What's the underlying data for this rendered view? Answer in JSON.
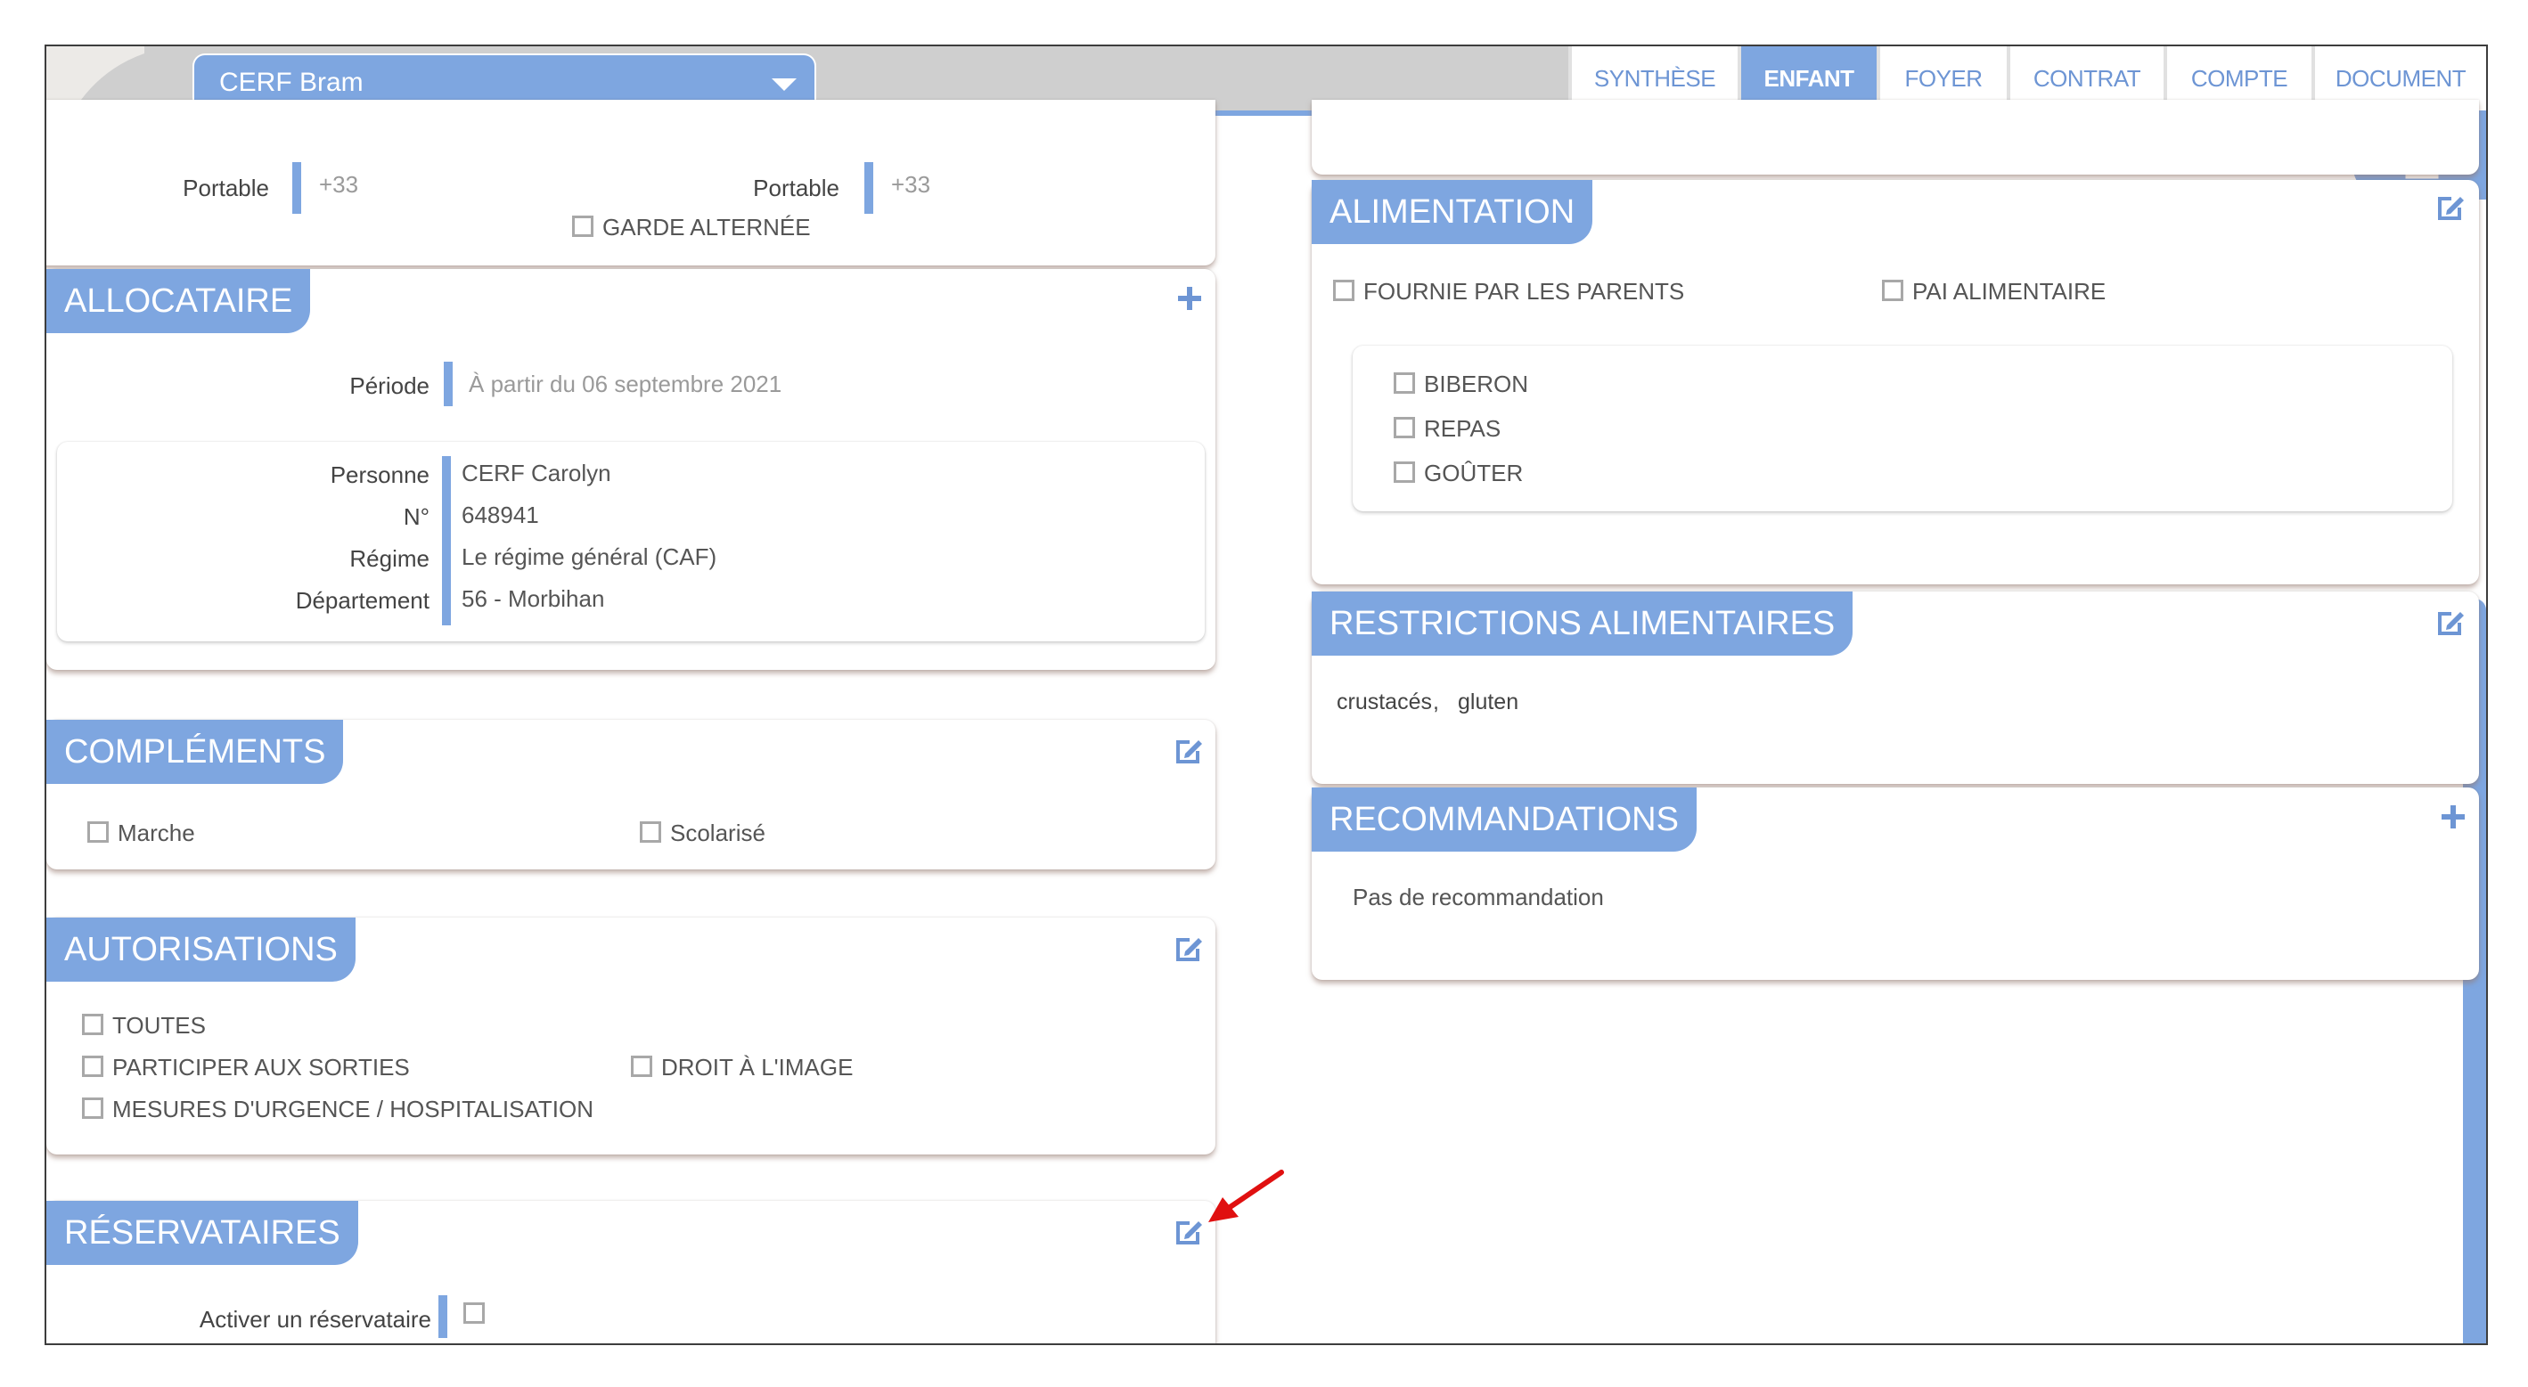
{
  "header": {
    "child_name": "CERF Bram",
    "tabs": [
      {
        "label": "SYNTHÈSE",
        "active": false
      },
      {
        "label": "ENFANT",
        "active": true
      },
      {
        "label": "FOYER",
        "active": false
      },
      {
        "label": "CONTRAT",
        "active": false
      },
      {
        "label": "COMPTE",
        "active": false
      },
      {
        "label": "DOCUMENT",
        "active": false
      }
    ]
  },
  "contacts": {
    "left_label": "Portable",
    "left_placeholder": "+33",
    "right_label": "Portable",
    "right_placeholder": "+33",
    "garde_alternee": "GARDE ALTERNÉE"
  },
  "allocataire": {
    "title": "ALLOCATAIRE",
    "periode_label": "Période",
    "periode_value": "À partir du 06 septembre 2021",
    "rows": [
      {
        "label": "Personne",
        "value": "CERF Carolyn"
      },
      {
        "label": "N°",
        "value": "648941"
      },
      {
        "label": "Régime",
        "value": "Le régime général (CAF)"
      },
      {
        "label": "Département",
        "value": "56 - Morbihan"
      }
    ]
  },
  "complements": {
    "title": "COMPLÉMENTS",
    "items": [
      "Marche",
      "Scolarisé"
    ]
  },
  "autorisations": {
    "title": "AUTORISATIONS",
    "items": [
      "TOUTES",
      "PARTICIPER AUX SORTIES",
      "DROIT À L'IMAGE",
      "MESURES D'URGENCE / HOSPITALISATION"
    ]
  },
  "reservataires": {
    "title": "RÉSERVATAIRES",
    "activate_label": "Activer un réservataire"
  },
  "alimentation": {
    "title": "ALIMENTATION",
    "options": [
      "FOURNIE PAR LES PARENTS",
      "PAI ALIMENTAIRE"
    ],
    "meals": [
      "BIBERON",
      "REPAS",
      "GOÛTER"
    ]
  },
  "restrictions": {
    "title": "RESTRICTIONS ALIMENTAIRES",
    "items": [
      "crustacés",
      "gluten"
    ],
    "separator": ","
  },
  "recommandations": {
    "title": "RECOMMANDATIONS",
    "text": "Pas de recommandation"
  },
  "icons": {
    "edit": "edit-icon",
    "add": "plus-icon",
    "printer": "printer-icon",
    "chevron": "chevron-down-icon",
    "annotation": "red-arrow-icon"
  },
  "colors": {
    "accent": "#7ea6e0",
    "tab_text": "#6d95d4",
    "annotation": "#e01010"
  }
}
